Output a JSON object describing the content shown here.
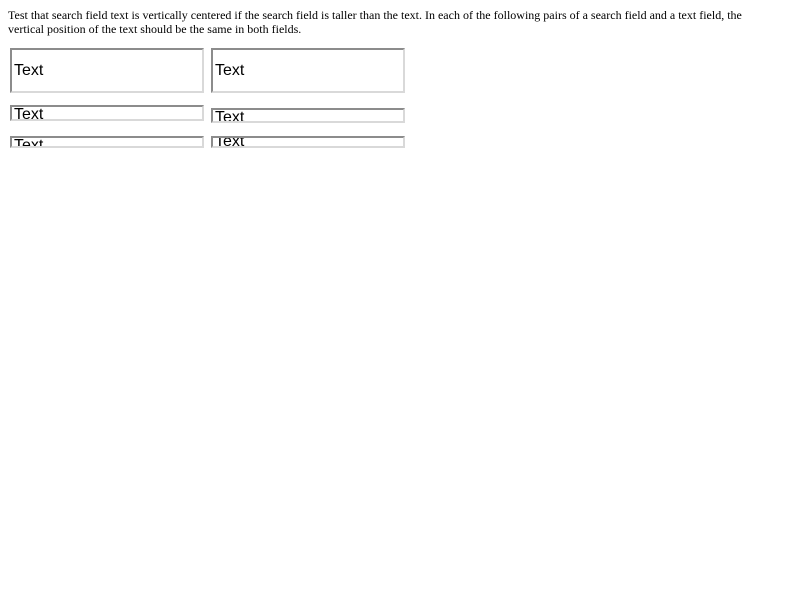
{
  "description": "Test that search field text is vertically centered if the search field is taller than the text. In each of the following pairs of a search field and a text field, the vertical position of the text should be the same in both fields.",
  "pairs": [
    {
      "search_field_value": "Text",
      "text_field_value": "Text"
    },
    {
      "search_field_value": "Text",
      "text_field_value": "Text"
    },
    {
      "search_field_value": "Text",
      "text_field_value": "Text"
    }
  ]
}
